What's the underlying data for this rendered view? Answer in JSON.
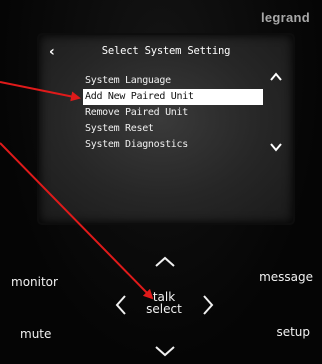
{
  "brand": "legrand",
  "screen": {
    "title": "Select System Setting",
    "back_icon": "chevron-left-icon",
    "menu_items": [
      {
        "label": "System Language",
        "selected": false
      },
      {
        "label": "Add New Paired Unit",
        "selected": true
      },
      {
        "label": "Remove Paired Unit",
        "selected": false
      },
      {
        "label": "System Reset",
        "selected": false
      },
      {
        "label": "System Diagnostics",
        "selected": false
      }
    ],
    "scroll_up_icon": "chevron-up-icon",
    "scroll_down_icon": "chevron-down-icon"
  },
  "buttons": {
    "monitor": "monitor",
    "message": "message",
    "mute": "mute",
    "setup": "setup",
    "talk": "talk",
    "select": "select"
  },
  "colors": {
    "annotation_arrow": "#e01a1a",
    "selected_row": "#ffffff",
    "screen_bg": "#2a2a2a"
  }
}
